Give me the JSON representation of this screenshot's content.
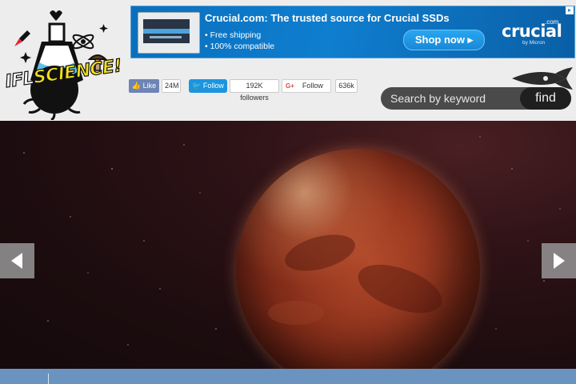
{
  "site": {
    "logo_text_a": "IFL",
    "logo_text_b": "SCIENCE!"
  },
  "ad": {
    "title": "Crucial.com: The trusted source for Crucial SSDs",
    "bullet1": "• Free shipping",
    "bullet2": "• 100% compatible",
    "cta": "Shop now ▸",
    "brand": "crucial",
    "brand_com": ".com",
    "brand_sub": "by Micron",
    "choice_icon": "adchoices-icon"
  },
  "social": {
    "like_label": "👍 Like",
    "like_count": "24M",
    "twitter_label": "Follow",
    "twitter_count": "192K followers",
    "gplus_mark": "G+",
    "gplus_label": "Follow",
    "gplus_count": "636k"
  },
  "search": {
    "placeholder": "Search by keyword",
    "button": "find"
  },
  "hero": {
    "prev_arrow": "◀",
    "next_arrow": "▶"
  },
  "colors": {
    "ad_blue": "#0f7ecf",
    "like_blue": "#6d84b4",
    "twitter_blue": "#1b95e0",
    "search_bg": "#4a4a4a",
    "nav_blue": "#6b93bf"
  }
}
